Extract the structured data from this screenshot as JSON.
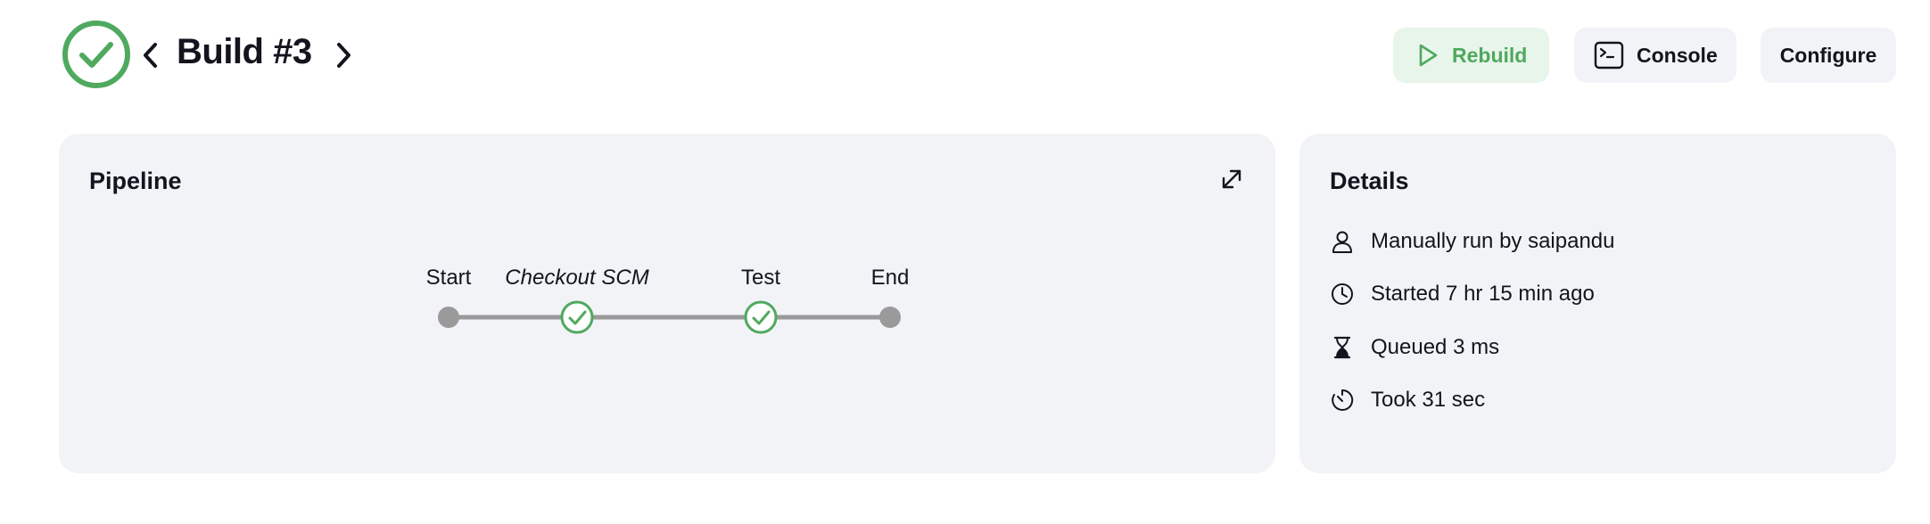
{
  "header": {
    "title": "Build #3",
    "status": "success",
    "prev_icon": "chevron-left-icon",
    "next_icon": "chevron-right-icon"
  },
  "toolbar": {
    "rebuild_label": "Rebuild",
    "console_label": "Console",
    "configure_label": "Configure"
  },
  "pipeline": {
    "title": "Pipeline",
    "stages": [
      {
        "label": "Start",
        "kind": "terminal",
        "italic": false
      },
      {
        "label": "Checkout SCM",
        "kind": "success",
        "italic": true
      },
      {
        "label": "Test",
        "kind": "success",
        "italic": false
      },
      {
        "label": "End",
        "kind": "terminal",
        "italic": false
      }
    ]
  },
  "details": {
    "title": "Details",
    "items": [
      {
        "icon": "user-icon",
        "text": "Manually run by saipandu"
      },
      {
        "icon": "clock-icon",
        "text": "Started 7 hr 15 min ago"
      },
      {
        "icon": "hourglass-icon",
        "text": "Queued 3 ms"
      },
      {
        "icon": "timer-icon",
        "text": "Took 31 sec"
      }
    ]
  },
  "colors": {
    "success": "#4fa95e",
    "success_bg": "#e8f5ea",
    "card_bg": "#f2f3f7",
    "line": "#9a9a9a",
    "text": "#14141f"
  }
}
